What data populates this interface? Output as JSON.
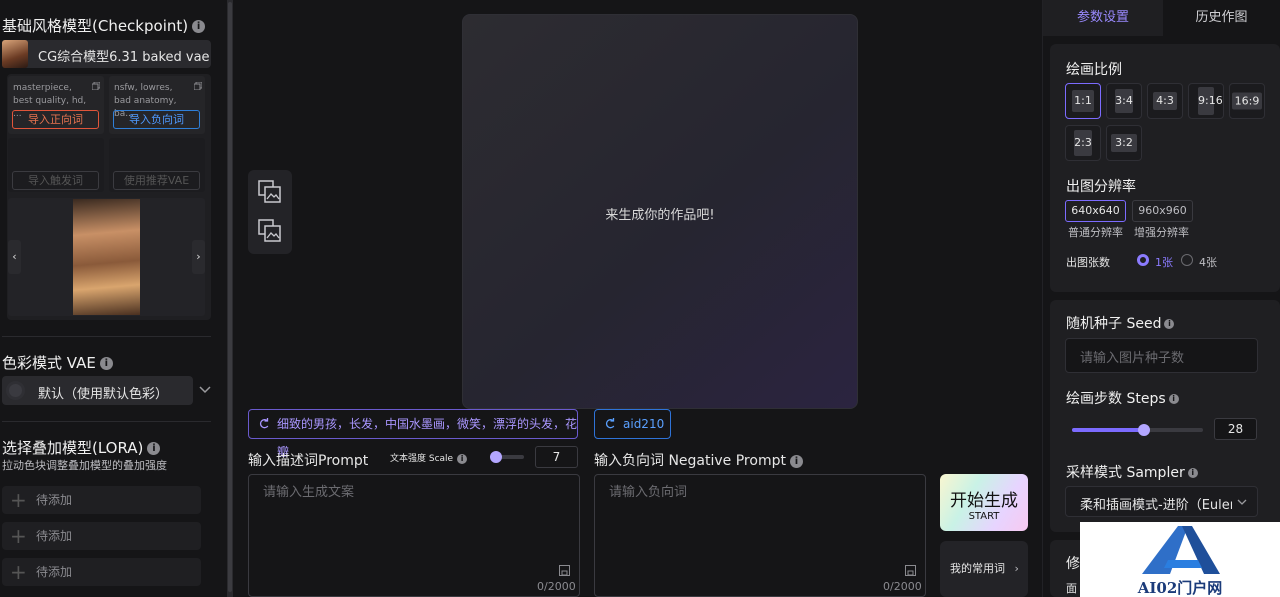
{
  "left": {
    "checkpoint_title": "基础风格模型(Checkpoint)",
    "checkpoint_model": "CG综合模型6.31 baked vae",
    "pos_snippet": "masterpiece, best quality, hd, ...",
    "neg_snippet": "nsfw, lowres, bad anatomy, ba...",
    "import_positive": "导入正向词",
    "import_negative": "导入负向词",
    "import_trigger": "导入触发词",
    "use_vae": "使用推荐VAE",
    "vae_title": "色彩模式 VAE",
    "vae_value": "默认（使用默认色彩）",
    "lora_title": "选择叠加模型(LORA)",
    "lora_desc": "拉动色块调整叠加模型的叠加强度",
    "lora_items": [
      "待添加",
      "待添加",
      "待添加"
    ]
  },
  "center": {
    "canvas_text": "来生成你的作品吧!",
    "positive_tag": "细致的男孩，长发，中国水墨画，微笑，漂浮的头发，花瓣",
    "negative_tag": "aid210",
    "prompt_label": "输入描述词Prompt",
    "scale_label": "文本强度 Scale",
    "scale_value": "7",
    "prompt_placeholder": "请输入生成文案",
    "prompt_counter": "0/2000",
    "neg_label": "输入负向词 Negative Prompt",
    "neg_placeholder": "请输入负向词",
    "neg_counter": "0/2000",
    "start_label": "开始生成",
    "start_sub": "START",
    "common_label": "我的常用词"
  },
  "right": {
    "tab_params": "参数设置",
    "tab_history": "历史作图",
    "ratio_title": "绘画比例",
    "ratios": [
      "1:1",
      "3:4",
      "4:3",
      "9:16",
      "16:9",
      "2:3",
      "3:2"
    ],
    "resolution_title": "出图分辨率",
    "res_normal": "640x640",
    "res_enhanced": "960x960",
    "res_normal_label": "普通分辨率",
    "res_enhanced_label": "增强分辨率",
    "count_label": "出图张数",
    "count_one": "1张",
    "count_four": "4张",
    "seed_title": "随机种子 Seed",
    "seed_placeholder": "请输入图片种子数",
    "steps_title": "绘画步数 Steps",
    "steps_value": "28",
    "steps_fraction": 0.55,
    "sampler_title": "采样模式 Sampler",
    "sampler_value": "柔和插画模式-进阶（Euler",
    "partial_title": "修",
    "partial_sub": "面"
  },
  "watermark": {
    "text": "AI02门户网"
  }
}
